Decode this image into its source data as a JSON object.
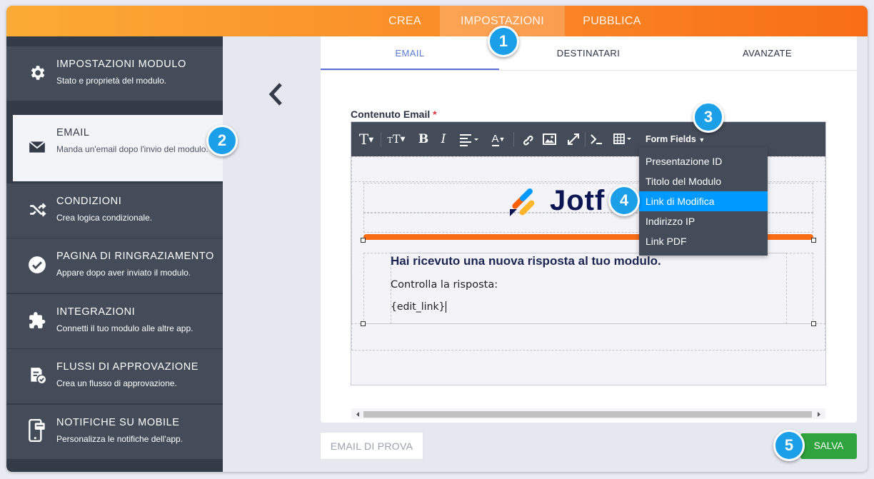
{
  "top_tabs": [
    {
      "label": "CREA"
    },
    {
      "label": "IMPOSTAZIONI"
    },
    {
      "label": "PUBBLICA"
    }
  ],
  "sidebar": {
    "items": [
      {
        "title": "IMPOSTAZIONI MODULO",
        "subtitle": "Stato e proprietà del modulo.",
        "icon": "gear-icon"
      },
      {
        "title": "EMAIL",
        "subtitle": "Manda un'email dopo l'invio del modulo.",
        "icon": "envelope-icon"
      },
      {
        "title": "CONDIZIONI",
        "subtitle": "Crea logica condizionale.",
        "icon": "shuffle-icon"
      },
      {
        "title": "PAGINA DI RINGRAZIAMENTO",
        "subtitle": "Appare dopo aver inviato il modulo.",
        "icon": "check-circle-icon"
      },
      {
        "title": "INTEGRAZIONI",
        "subtitle": "Connetti il tuo modulo alle altre app.",
        "icon": "puzzle-icon"
      },
      {
        "title": "FLUSSI DI APPROVAZIONE",
        "subtitle": "Crea un flusso di approvazione.",
        "icon": "approval-document-icon"
      },
      {
        "title": "NOTIFICHE SU MOBILE",
        "subtitle": "Personalizza le notifiche dell'app.",
        "icon": "mobile-notification-icon"
      }
    ]
  },
  "sub_tabs": [
    {
      "label": "EMAIL"
    },
    {
      "label": "DESTINATARI"
    },
    {
      "label": "AVANZATE"
    }
  ],
  "editor": {
    "label": "Contenuto Email",
    "required_mark": "*",
    "form_fields_label": "Form Fields",
    "form_fields_options": [
      "Presentazione ID",
      "Titolo del Modulo",
      "Link di Modifica",
      "Indirizzo IP",
      "Link PDF"
    ],
    "highlighted_option": "Link di Modifica",
    "logo_text": "Jotf",
    "email_heading": "Hai ricevuto una nuova risposta al tuo modulo.",
    "email_line1": "Controlla la risposta:",
    "email_line2": "{edit_link}"
  },
  "buttons": {
    "test_email": "EMAIL DI PROVA",
    "save": "SALVA"
  },
  "callouts": [
    "1",
    "2",
    "3",
    "4",
    "5"
  ],
  "colors": {
    "accent_orange": "#f86e16",
    "sidebar_bg": "#343b48",
    "active_tab": "#5b6ed3",
    "save_green": "#2fa33d",
    "callout_blue": "#1a9fe8",
    "highlight_blue": "#0099ff"
  }
}
